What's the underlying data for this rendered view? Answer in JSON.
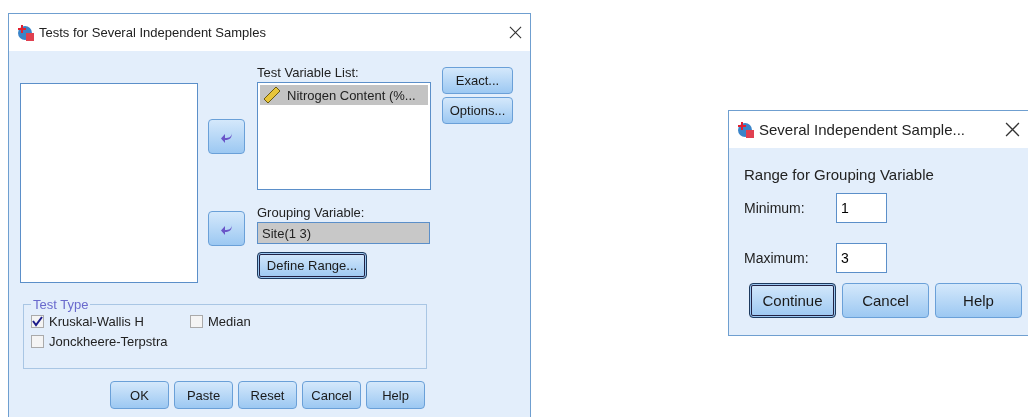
{
  "main_dialog": {
    "title": "Tests for Several Independent Samples",
    "side_buttons": [
      {
        "label": "Exact..."
      },
      {
        "label": "Options..."
      }
    ],
    "test_variable_list": {
      "label": "Test Variable List:",
      "items": [
        {
          "name": "Nitrogen Content (%...",
          "selected": true
        }
      ]
    },
    "grouping_variable": {
      "label": "Grouping Variable:",
      "value": "Site(1 3)"
    },
    "define_range_button": {
      "label": "Define Range...",
      "focused": true
    },
    "test_type": {
      "title": "Test Type",
      "options": [
        {
          "label": "Kruskal-Wallis H",
          "checked": true
        },
        {
          "label": "Median",
          "checked": false
        },
        {
          "label": "Jonckheere-Terpstra",
          "checked": false
        }
      ]
    },
    "buttons": [
      {
        "label": "OK"
      },
      {
        "label": "Paste"
      },
      {
        "label": "Reset"
      },
      {
        "label": "Cancel"
      },
      {
        "label": "Help"
      }
    ]
  },
  "range_dialog": {
    "title": "Several Independent Sample...",
    "heading": "Range for Grouping Variable",
    "fields": [
      {
        "label": "Minimum:",
        "value": "1"
      },
      {
        "label": "Maximum:",
        "value": "3"
      }
    ],
    "buttons": [
      {
        "label": "Continue",
        "focused": true
      },
      {
        "label": "Cancel",
        "focused": false
      },
      {
        "label": "Help",
        "focused": false
      }
    ]
  }
}
